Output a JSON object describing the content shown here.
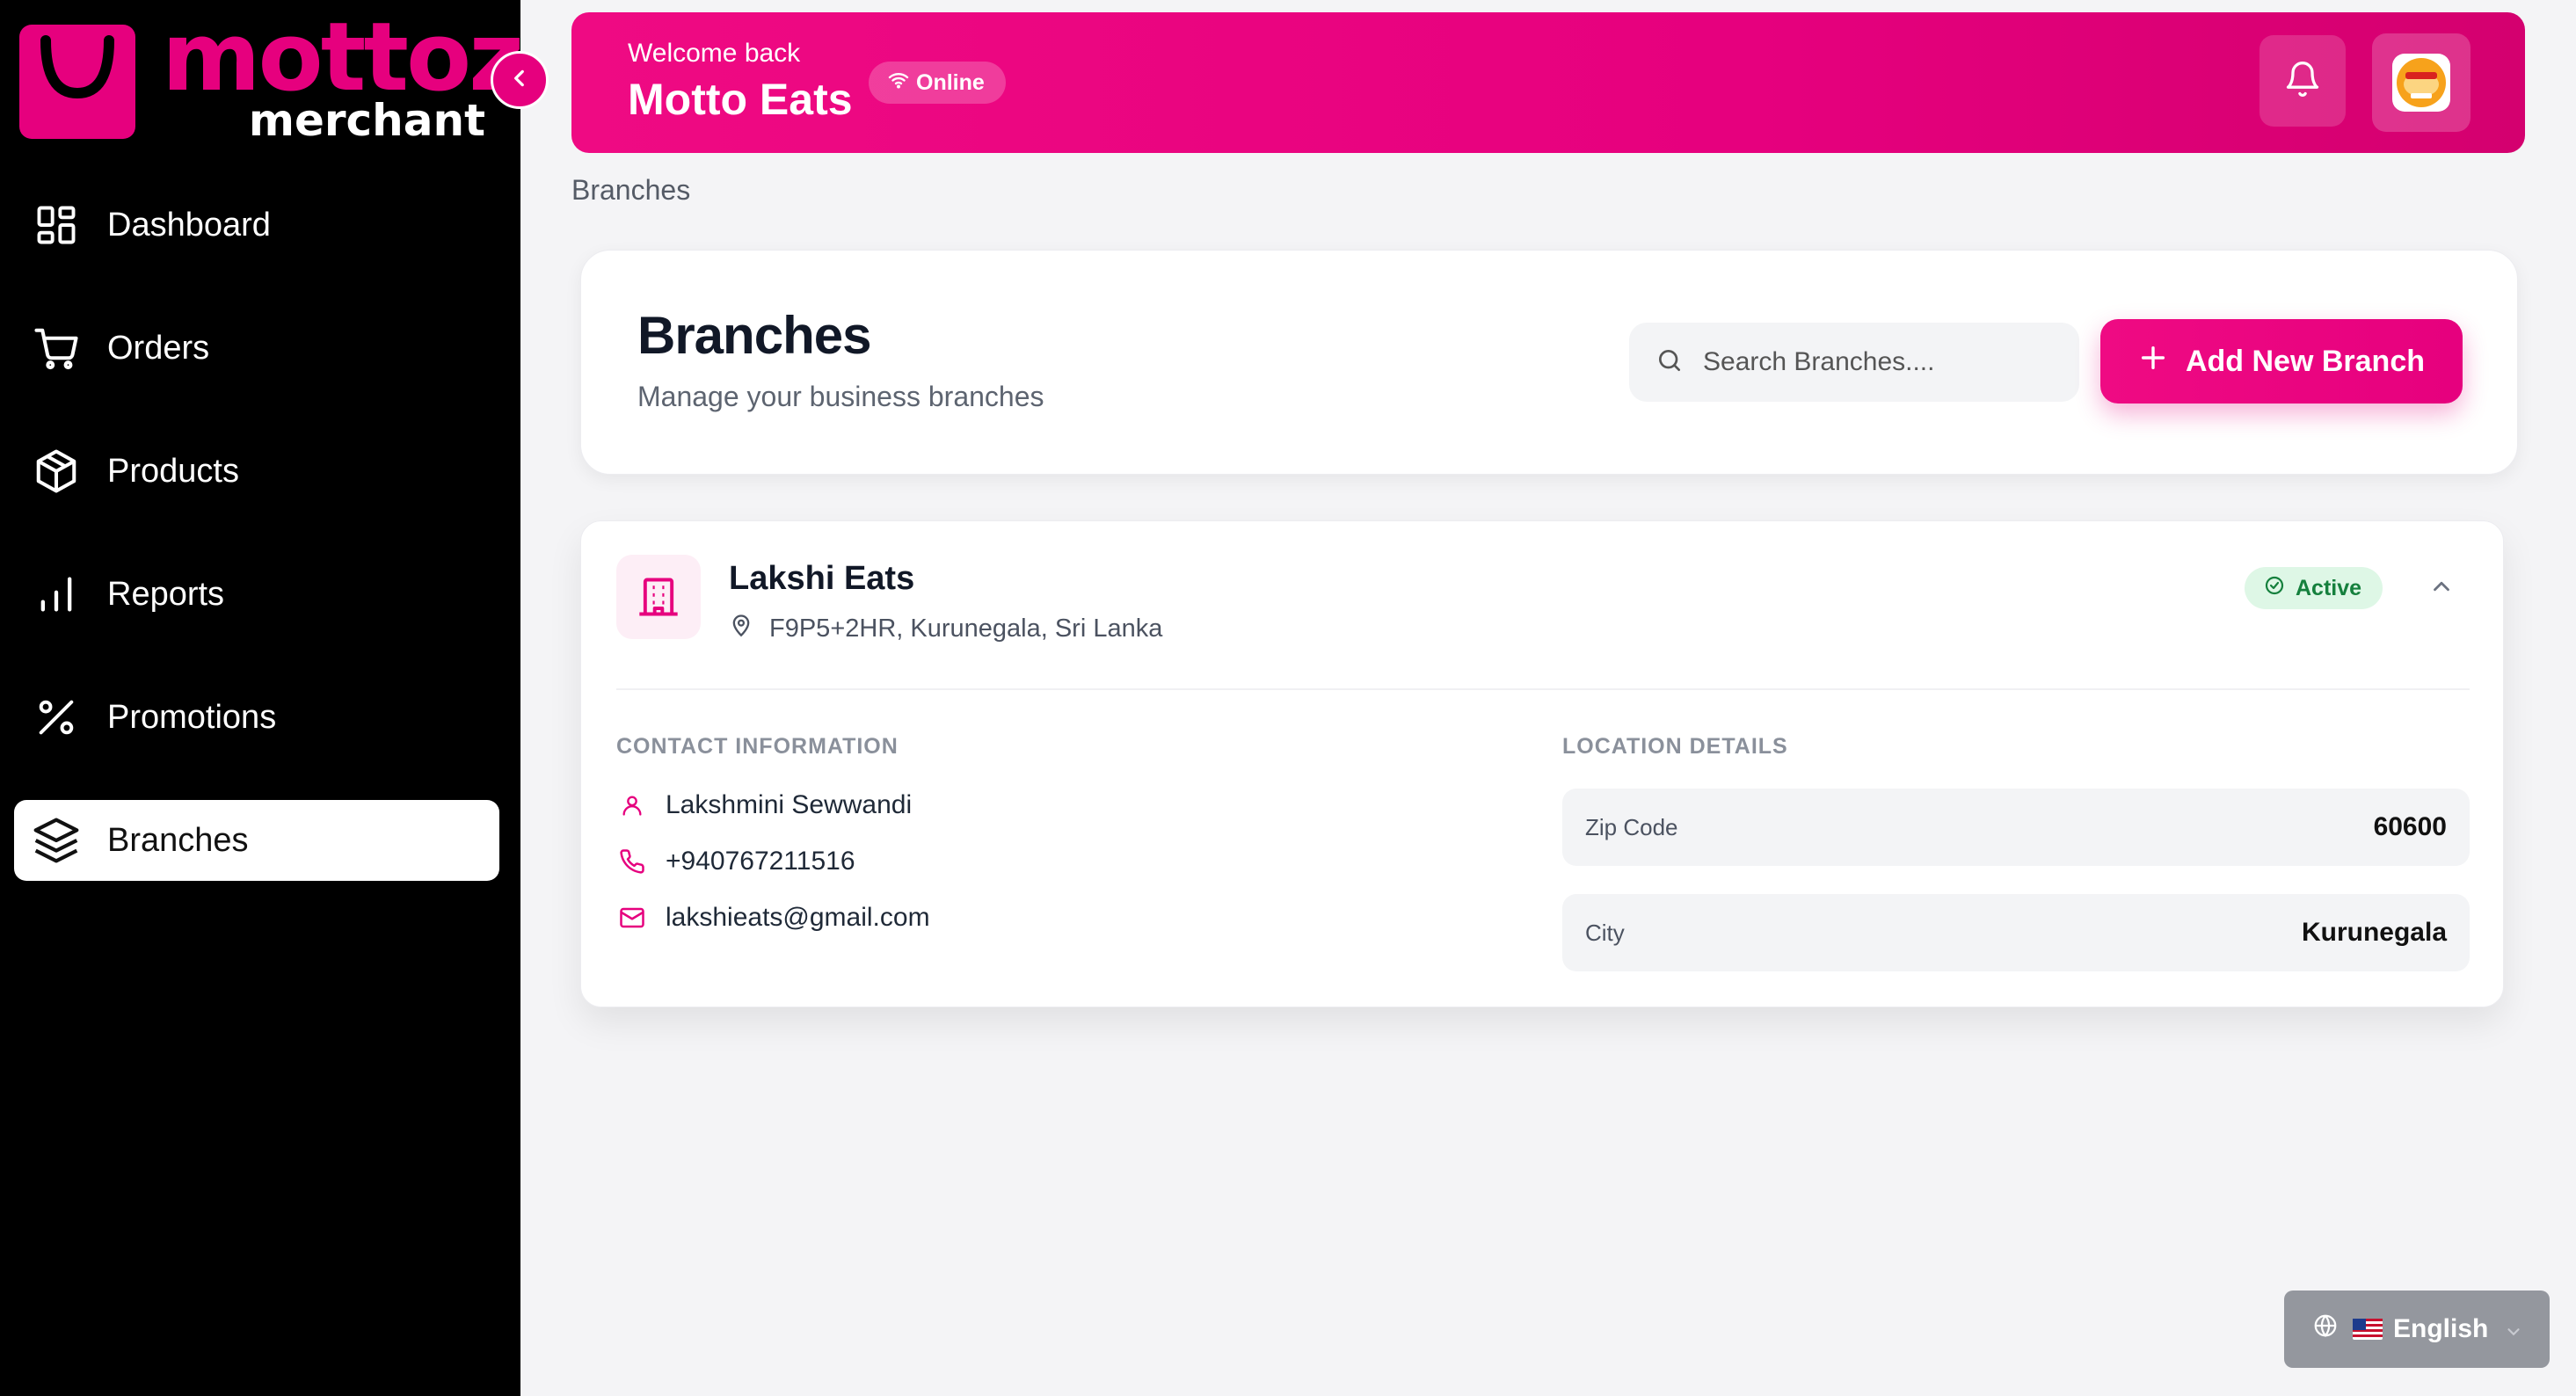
{
  "brand": {
    "name": "mottoz",
    "sub": "merchant",
    "color": "#e6007e"
  },
  "sidebar": {
    "collapse_icon": "chevron-left-icon",
    "items": [
      {
        "label": "Dashboard",
        "icon": "dashboard-icon",
        "active": false
      },
      {
        "label": "Orders",
        "icon": "cart-icon",
        "active": false
      },
      {
        "label": "Products",
        "icon": "box-icon",
        "active": false
      },
      {
        "label": "Reports",
        "icon": "bar-chart-icon",
        "active": false
      },
      {
        "label": "Promotions",
        "icon": "percent-icon",
        "active": false
      },
      {
        "label": "Branches",
        "icon": "layers-icon",
        "active": true
      }
    ]
  },
  "header": {
    "welcome": "Welcome back",
    "store_name": "Motto Eats",
    "status": "Online",
    "bell_icon": "bell-icon",
    "avatar_icon": "store-avatar"
  },
  "breadcrumb": "Branches",
  "page": {
    "title": "Branches",
    "subtitle": "Manage your business branches",
    "search_placeholder": "Search Branches....",
    "search_value": "",
    "add_label": "Add New Branch"
  },
  "branch": {
    "name": "Lakshi Eats",
    "address": "F9P5+2HR, Kurunegala, Sri Lanka",
    "status": "Active",
    "contact_label": "CONTACT INFORMATION",
    "contact_name": "Lakshmini Sewwandi",
    "phone": "+940767211516",
    "email": "lakshieats@gmail.com",
    "location_label": "LOCATION DETAILS",
    "zip_label": "Zip Code",
    "zip_value": "60600",
    "city_label": "City",
    "city_value": "Kurunegala"
  },
  "language": {
    "selected": "English",
    "flag_icon": "us-flag-icon"
  },
  "colors": {
    "accent": "#e6007e",
    "success": "#15803d",
    "success_bg": "#def7e6"
  }
}
